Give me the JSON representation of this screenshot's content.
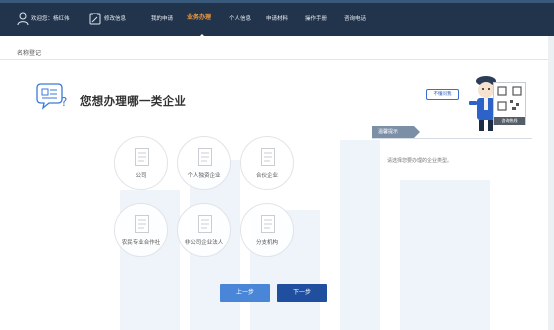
{
  "nav": {
    "welcome": "欢迎您：杨红伟",
    "edit_info": "修改信息",
    "items": [
      "我的申请",
      "业务办理",
      "个人信息",
      "申请材料",
      "操作手册",
      "咨询电话"
    ],
    "active_index": 1
  },
  "breadcrumb": "名称登记",
  "question": {
    "title": "您想办理哪一类企业"
  },
  "options": [
    {
      "label": "公司"
    },
    {
      "label": "个人独资企业"
    },
    {
      "label": "合伙企业"
    },
    {
      "label": "农民专业合作社"
    },
    {
      "label": "非公司企业法人"
    },
    {
      "label": "分支机构"
    }
  ],
  "buttons": {
    "prev": "上一步",
    "next": "下一步"
  },
  "tips": {
    "tab": "温馨提示",
    "text": "请选择您要办理的企业类型。"
  },
  "mascot": {
    "bubble": "不懂问我",
    "qr_label": "咨询热线"
  },
  "colors": {
    "topbar": "#22344c",
    "active": "#f39a3a",
    "button": "#2b62c0"
  }
}
